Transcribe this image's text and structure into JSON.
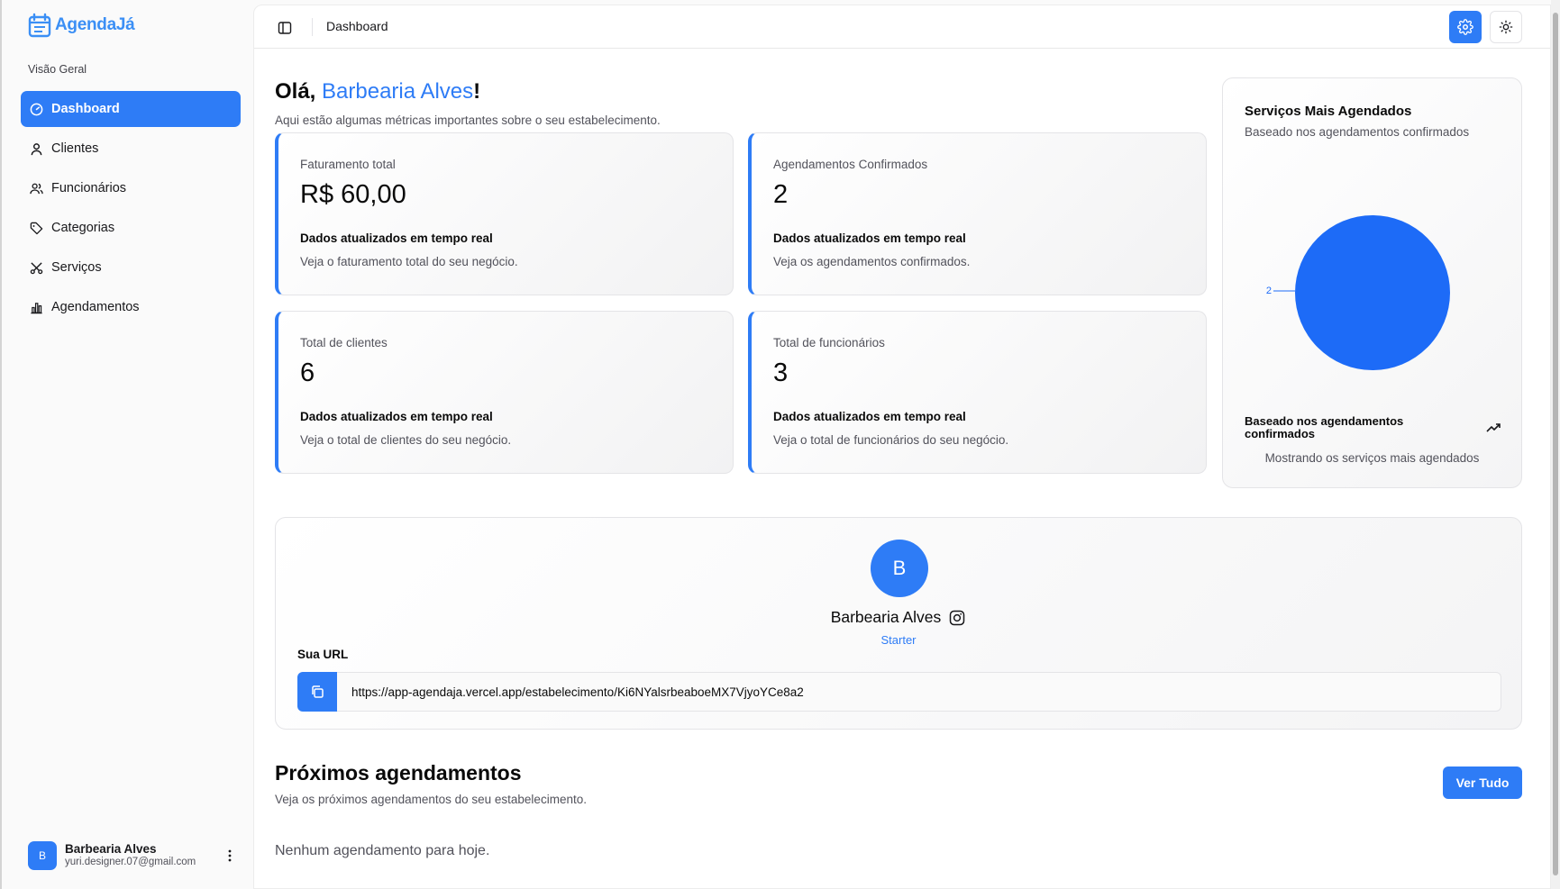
{
  "app": {
    "name": "AgendaJá"
  },
  "sidebar": {
    "group_label": "Visão Geral",
    "items": [
      {
        "label": "Dashboard",
        "icon": "gauge-icon",
        "active": true
      },
      {
        "label": "Clientes",
        "icon": "user-icon"
      },
      {
        "label": "Funcionários",
        "icon": "users-icon"
      },
      {
        "label": "Categorias",
        "icon": "tag-icon"
      },
      {
        "label": "Serviços",
        "icon": "tools-icon"
      },
      {
        "label": "Agendamentos",
        "icon": "bar-chart-icon"
      }
    ],
    "user": {
      "initial": "B",
      "name": "Barbearia Alves",
      "email": "yuri.designer.07@gmail.com"
    }
  },
  "header": {
    "breadcrumb": "Dashboard"
  },
  "greeting": {
    "prefix": "Olá, ",
    "name": "Barbearia Alves",
    "suffix": "!",
    "subtitle": "Aqui estão algumas métricas importantes sobre o seu estabelecimento."
  },
  "cards": [
    {
      "title": "Faturamento total",
      "value": "R$ 60,00",
      "heading": "Dados atualizados em tempo real",
      "description": "Veja o faturamento total do seu negócio."
    },
    {
      "title": "Agendamentos Confirmados",
      "value": "2",
      "heading": "Dados atualizados em tempo real",
      "description": "Veja os agendamentos confirmados."
    },
    {
      "title": "Total de clientes",
      "value": "6",
      "heading": "Dados atualizados em tempo real",
      "description": "Veja o total de clientes do seu negócio."
    },
    {
      "title": "Total de funcionários",
      "value": "3",
      "heading": "Dados atualizados em tempo real",
      "description": "Veja o total de funcionários do seu negócio."
    }
  ],
  "chart_card": {
    "title": "Serviços Mais Agendados",
    "subtitle": "Baseado nos agendamentos confirmados",
    "footer": "Baseado nos agendamentos confirmados",
    "caption": "Mostrando os serviços mais agendados"
  },
  "chart_data": {
    "type": "pie",
    "values": [
      2
    ],
    "labels": [
      "2"
    ],
    "colors": [
      "#1d6bf7"
    ]
  },
  "profile": {
    "initial": "B",
    "name": "Barbearia Alves",
    "plan": "Starter",
    "url_label": "Sua URL",
    "url": "https://app-agendaja.vercel.app/estabelecimento/Ki6NYalsrbeaboeMX7VjyoYCe8a2"
  },
  "next": {
    "title": "Próximos agendamentos",
    "subtitle": "Veja os próximos agendamentos do seu estabelecimento.",
    "see_all": "Ver Tudo",
    "empty": "Nenhum agendamento para hoje."
  },
  "colors": {
    "accent": "#2e7cf6",
    "pie": "#1d6bf7"
  }
}
